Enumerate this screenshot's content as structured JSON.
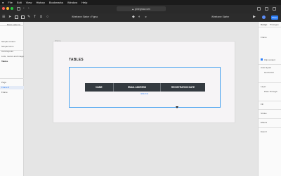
{
  "menubar": {
    "items": [
      "File",
      "Edit",
      "View",
      "History",
      "Bookmarks",
      "Window",
      "Help"
    ]
  },
  "browser": {
    "url": "pinegrow.com"
  },
  "appbar": {
    "document_title": "Wireframe Starter • Figma",
    "right_text": "Wireframe Starter",
    "share_label": "Share"
  },
  "left_panel": {
    "items": [
      "Basic patterns",
      "Simple content",
      "Simple forms",
      "Card layouts",
      "Lists, menus and images",
      "Tables",
      "Page",
      "Frame 9",
      "Frame"
    ]
  },
  "canvas": {
    "frame_label": "Frame",
    "page_title": "TABLES",
    "table_headers": [
      "NAME",
      "EMAIL ADDRESS",
      "REGISTRATION DATE"
    ],
    "link_text": "table link"
  },
  "right_panel": {
    "tabs": [
      "Design",
      "Prototype"
    ],
    "sections": [
      "Frame",
      "Clip content",
      "Auto layout",
      "Horizontal",
      "Layer",
      "Pass Through",
      "Fill",
      "Stroke",
      "Effects",
      "Export"
    ]
  },
  "colors": {
    "table_header": "#343a40",
    "selection": "#4aa3f0",
    "accent": "#2d7ff9"
  }
}
